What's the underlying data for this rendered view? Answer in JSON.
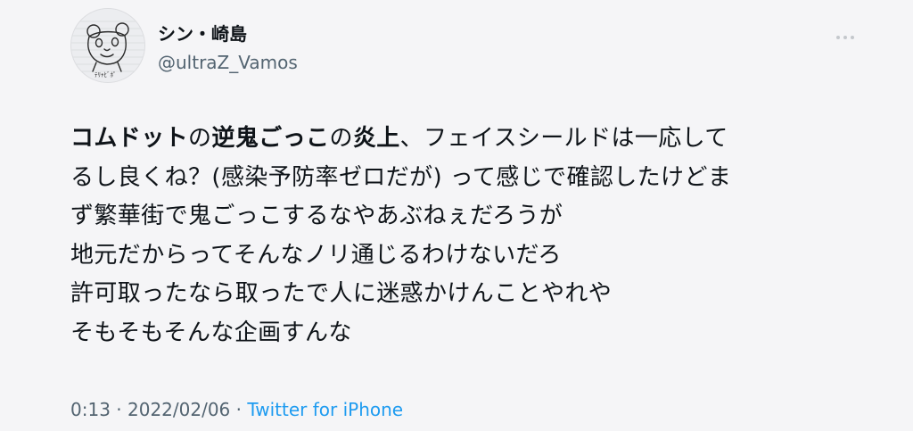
{
  "author": {
    "display_name": "シン・崎島",
    "handle": "@ultraZ_Vamos",
    "avatar_caption": "ﾃﾘｬﾋﾞﾎﾟ"
  },
  "tweet": {
    "lines": [
      [
        {
          "text": "コムドット",
          "bold": true
        },
        {
          "text": "の",
          "bold": false
        },
        {
          "text": "逆鬼ごっこ",
          "bold": true
        },
        {
          "text": "の",
          "bold": false
        },
        {
          "text": "炎上",
          "bold": true
        },
        {
          "text": "、フェイスシールドは一応して",
          "bold": false
        }
      ],
      [
        {
          "text": "るし良くね？(感染予防率ゼロだが) って感じで確認したけどま",
          "bold": false
        }
      ],
      [
        {
          "text": "ず繁華街で鬼ごっこするなやあぶねぇだろうが",
          "bold": false
        }
      ],
      [
        {
          "text": "地元だからってそんなノリ通じるわけないだろ",
          "bold": false
        }
      ],
      [
        {
          "text": "許可取ったなら取ったで人に迷惑かけんことやれや",
          "bold": false
        }
      ],
      [
        {
          "text": "そもそもそんな企画すんな",
          "bold": false
        }
      ]
    ]
  },
  "meta": {
    "time": "0:13",
    "separator": " · ",
    "date": "2022/02/06",
    "source": "Twitter for iPhone"
  },
  "icons": {
    "more": "more-horizontal-icon"
  },
  "colors": {
    "background": "#f5f5f7",
    "text": "#0f1419",
    "secondary": "#536471",
    "link": "#1d9bf0"
  }
}
